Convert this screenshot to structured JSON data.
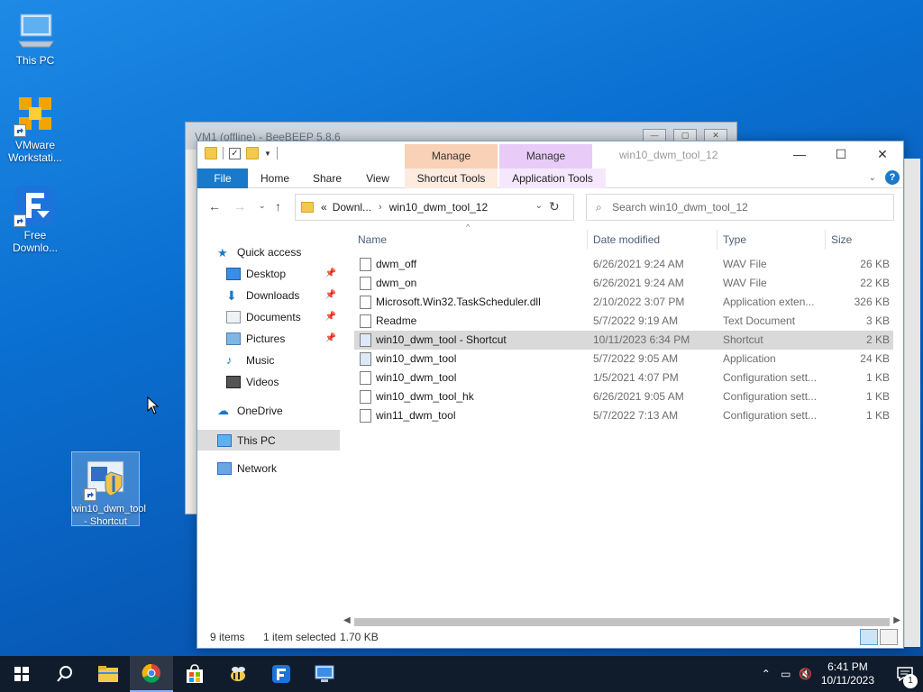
{
  "desktop": {
    "icons": [
      {
        "label": "This PC",
        "icon": "computer-icon"
      },
      {
        "label": "VMware Workstati...",
        "icon": "vmware-icon"
      },
      {
        "label": "Free Downlo...",
        "icon": "free-download-manager-icon"
      },
      {
        "label": "win10_dwm_tool - Shortcut",
        "icon": "app-shortcut-icon"
      }
    ]
  },
  "background_window": {
    "title": "VM1 (offline) - BeeBEEP 5.8.6"
  },
  "explorer": {
    "window_title": "win10_dwm_tool_12",
    "contextual_tabs": [
      "Manage",
      "Manage"
    ],
    "ribbon_tabs": [
      "File",
      "Home",
      "Share",
      "View",
      "Shortcut Tools",
      "Application Tools"
    ],
    "address": {
      "prefix": "«",
      "crumbs": [
        "Downl...",
        "win10_dwm_tool_12"
      ]
    },
    "search": {
      "placeholder": "Search win10_dwm_tool_12"
    },
    "nav": {
      "quick_access": "Quick access",
      "items": [
        {
          "label": "Desktop",
          "icon": "desktop-folder-icon",
          "pinned": true
        },
        {
          "label": "Downloads",
          "icon": "downloads-folder-icon",
          "pinned": true
        },
        {
          "label": "Documents",
          "icon": "documents-folder-icon",
          "pinned": true
        },
        {
          "label": "Pictures",
          "icon": "pictures-folder-icon",
          "pinned": true
        },
        {
          "label": "Music",
          "icon": "music-folder-icon",
          "pinned": false
        },
        {
          "label": "Videos",
          "icon": "videos-folder-icon",
          "pinned": false
        }
      ],
      "onedrive": "OneDrive",
      "this_pc": "This PC",
      "network": "Network"
    },
    "columns": {
      "name": "Name",
      "date": "Date modified",
      "type": "Type",
      "size": "Size"
    },
    "files": [
      {
        "name": "dwm_off",
        "date": "6/26/2021 9:24 AM",
        "type": "WAV File",
        "size": "26 KB",
        "selected": false
      },
      {
        "name": "dwm_on",
        "date": "6/26/2021 9:24 AM",
        "type": "WAV File",
        "size": "22 KB",
        "selected": false
      },
      {
        "name": "Microsoft.Win32.TaskScheduler.dll",
        "date": "2/10/2022 3:07 PM",
        "type": "Application exten...",
        "size": "326 KB",
        "selected": false
      },
      {
        "name": "Readme",
        "date": "5/7/2022 9:19 AM",
        "type": "Text Document",
        "size": "3 KB",
        "selected": false
      },
      {
        "name": "win10_dwm_tool - Shortcut",
        "date": "10/11/2023 6:34 PM",
        "type": "Shortcut",
        "size": "2 KB",
        "selected": true
      },
      {
        "name": "win10_dwm_tool",
        "date": "5/7/2022 9:05 AM",
        "type": "Application",
        "size": "24 KB",
        "selected": false
      },
      {
        "name": "win10_dwm_tool",
        "date": "1/5/2021 4:07 PM",
        "type": "Configuration sett...",
        "size": "1 KB",
        "selected": false
      },
      {
        "name": "win10_dwm_tool_hk",
        "date": "6/26/2021 9:05 AM",
        "type": "Configuration sett...",
        "size": "1 KB",
        "selected": false
      },
      {
        "name": "win11_dwm_tool",
        "date": "5/7/2022 7:13 AM",
        "type": "Configuration sett...",
        "size": "1 KB",
        "selected": false
      }
    ],
    "status": {
      "count": "9 items",
      "selection": "1 item selected",
      "size": "1.70 KB"
    }
  },
  "taskbar": {
    "apps": [
      "start-icon",
      "search-icon",
      "file-explorer-icon",
      "chrome-icon",
      "store-icon",
      "beebeep-icon",
      "free-download-manager-icon",
      "remote-desktop-icon"
    ],
    "clock_time": "6:41 PM",
    "clock_date": "10/11/2023",
    "notification_count": "1"
  }
}
